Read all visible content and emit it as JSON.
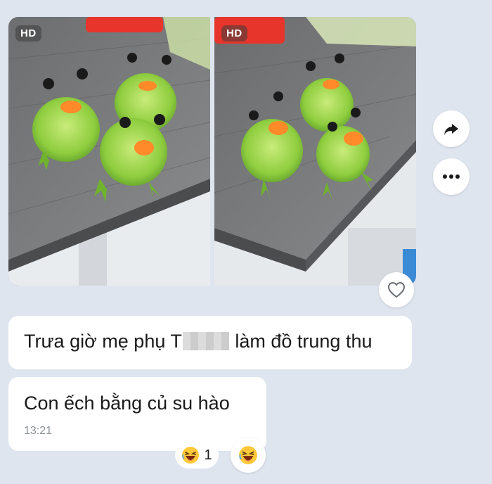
{
  "images": [
    {
      "badge": "HD"
    },
    {
      "badge": "HD"
    }
  ],
  "actions": {
    "forward_icon": "share-arrow-icon",
    "more_icon": "more-horizontal-icon",
    "like_icon": "heart-outline-icon"
  },
  "messages": [
    {
      "text_before": "Trưa giờ mẹ phụ T",
      "text_after": " làm đồ trung thu"
    },
    {
      "text": "Con ếch bằng củ su hào",
      "time": "13:21"
    }
  ],
  "reactions": {
    "emoji": "laughing-face",
    "count": "1"
  }
}
